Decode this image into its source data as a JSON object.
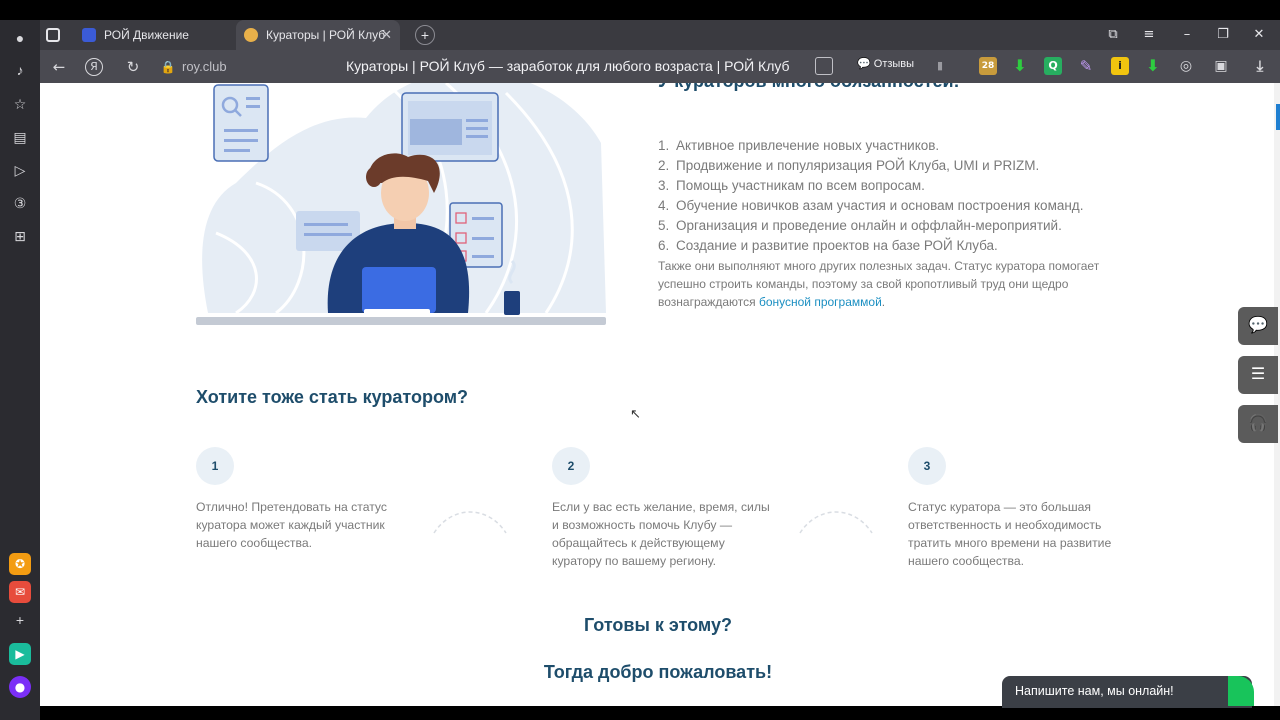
{
  "browser": {
    "tabs": [
      {
        "label": "РОЙ Движение"
      },
      {
        "label": "Кураторы | РОЙ Клуб"
      }
    ],
    "domain": "roy.club",
    "page_title": "Кураторы | РОЙ Клуб — заработок для любого возраста | РОЙ Клуб",
    "reviews_label": "Отзывы",
    "badge_count": "28"
  },
  "content": {
    "heading_cut": "У кураторов много обязанностей:",
    "duties": [
      {
        "num": "1.",
        "text": "Активное привлечение новых участников."
      },
      {
        "num": "2.",
        "text": "Продвижение и популяризация РОЙ Клуба, UMI и PRIZM."
      },
      {
        "num": "3.",
        "text": "Помощь участникам по всем вопросам."
      },
      {
        "num": "4.",
        "text": "Обучение новичков азам участия и основам построения команд."
      },
      {
        "num": "5.",
        "text": "Организация и проведение онлайн и оффлайн-мероприятий."
      },
      {
        "num": "6.",
        "text": "Создание и развитие проектов на базе РОЙ Клуба."
      }
    ],
    "extra_text": "Также они выполняют много других полезных задач. Статус куратора помогает успешно строить команды, поэтому за свой кропотливый труд они щедро вознаграждаются ",
    "extra_link": "бонусной программой",
    "extra_end": ".",
    "become_heading": "Хотите тоже стать куратором?",
    "steps": [
      {
        "num": "1",
        "text": "Отлично! Претендовать на статус куратора может каждый участник нашего сообщества."
      },
      {
        "num": "2",
        "text": "Если у вас есть желание, время, силы и возможность помочь Клубу — обращайтесь к действующему куратору по вашему региону."
      },
      {
        "num": "3",
        "text": "Статус куратора — это большая ответственность и необходимость тратить много времени на развитие нашего сообщества."
      }
    ],
    "ready": "Готовы к этому?",
    "welcome": "Тогда добро пожаловать!",
    "chat_label": "Напишите нам, мы онлайн!"
  },
  "colors": {
    "heading": "#1e4d6b",
    "link": "#1b8fc2",
    "chat_green": "#18c45b"
  }
}
